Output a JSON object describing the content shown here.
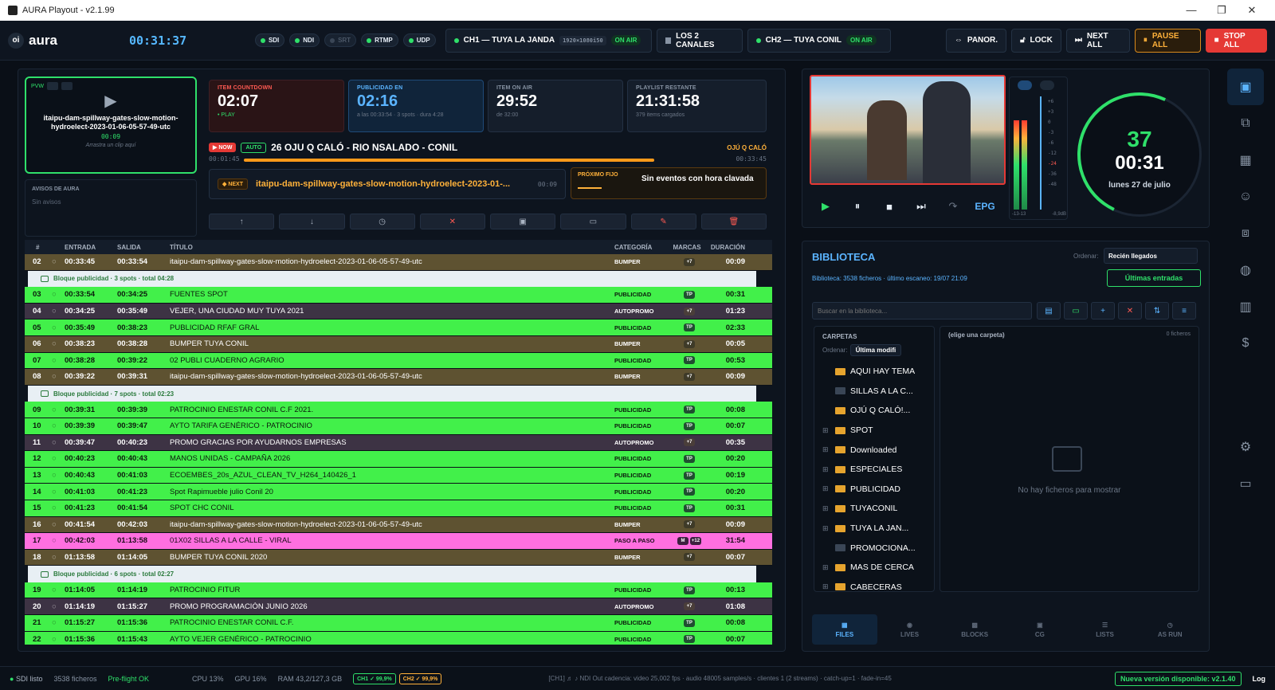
{
  "window": {
    "title": "AURA Playout - v2.1.99",
    "controls": [
      "—",
      "❐",
      "✕"
    ]
  },
  "top": {
    "logo_mark": "oi",
    "logo": "aura",
    "clock": "00:31:37",
    "io": [
      {
        "label": "SDI",
        "on": true
      },
      {
        "label": "NDI",
        "on": true
      },
      {
        "label": "SRT",
        "on": false
      },
      {
        "label": "RTMP",
        "on": true
      },
      {
        "label": "UDP",
        "on": true
      }
    ],
    "ch1": {
      "label": "CH1 — TUYA LA JANDA",
      "res": "1920×1080i50",
      "status": "ON AIR"
    },
    "both": "LOS 2 CANALES",
    "ch2": {
      "label": "CH2 — TUYA CONIL",
      "status": "ON AIR"
    },
    "buttons": {
      "panor": "PANOR.",
      "lock": "LOCK",
      "next_all": "NEXT ALL",
      "pause_all": "PAUSE ALL",
      "stop_all": "STOP ALL"
    }
  },
  "pvw": {
    "tag": "PVW",
    "file": "itaipu-dam-spillway-gates-slow-motion-hydroelect-2023-01-06-05-57-49-utc",
    "dur": "00:09",
    "hint": "Arrastra un clip aquí"
  },
  "avisos": {
    "title": "AVISOS DE AURA",
    "body": "Sin avisos"
  },
  "cards": [
    {
      "label": "ITEM COUNTDOWN",
      "value": "02:07",
      "sub": "• PLAY"
    },
    {
      "label": "PUBLICIDAD EN",
      "value": "02:16",
      "sub": "a las 00:33:54 · 3 spots · dura 4:28"
    },
    {
      "label": "ITEM ON AIR",
      "value": "29:52",
      "sub": "de 32:00"
    },
    {
      "label": "PLAYLIST RESTANTE",
      "value": "21:31:58",
      "sub": "379 items cargados"
    }
  ],
  "now": {
    "badge": "▶ NOW",
    "auto": "AUTO",
    "title": "26 OJU Q CALÓ - RIO NSALADO - CONIL",
    "category": "OJÚ Q CALÓ",
    "elapsed": "00:01:45",
    "total": "00:33:45",
    "progress": 0.9
  },
  "next": {
    "badge": "◆ NEXT",
    "title": "itaipu-dam-spillway-gates-slow-motion-hydroelect-2023-01-...",
    "dur": "00:09"
  },
  "fijo": {
    "label": "PRÓXIMO FIJO",
    "value": "Sin eventos con hora clavada"
  },
  "actions": [
    "↑",
    "↓",
    "◷",
    "✕",
    "▣",
    "▭",
    "✎",
    "🗑"
  ],
  "playlist": {
    "headers": [
      "#",
      "",
      "ENTRADA",
      "SALIDA",
      "TÍTULO",
      "CATEGORÍA",
      "MARCAS",
      "DURACIÓN"
    ],
    "rows": [
      {
        "t": "r",
        "n": "02",
        "in": "00:33:45",
        "out": "00:33:54",
        "title": "itaipu-dam-spillway-gates-slow-motion-hydroelect-2023-01-06-05-57-49-utc",
        "cat": "BUMPER",
        "mk": [
          "+7"
        ],
        "dur": "00:09",
        "cls": "bump"
      },
      {
        "t": "b",
        "label": "Bloque publicidad · 3 spots · total 04:28"
      },
      {
        "t": "r",
        "n": "03",
        "in": "00:33:54",
        "out": "00:34:25",
        "title": "FUENTES SPOT",
        "cat": "PUBLICIDAD",
        "mk": [
          "TP"
        ],
        "dur": "00:31",
        "cls": "spot"
      },
      {
        "t": "r",
        "n": "04",
        "in": "00:34:25",
        "out": "00:35:49",
        "title": "VEJER, UNA CIUDAD MUY TUYA 2021",
        "cat": "AUTOPROMO",
        "mk": [
          "+7"
        ],
        "dur": "01:23",
        "cls": "auto"
      },
      {
        "t": "r",
        "n": "05",
        "in": "00:35:49",
        "out": "00:38:23",
        "title": "PUBLICIDAD RFAF GRAL",
        "cat": "PUBLICIDAD",
        "mk": [
          "TP"
        ],
        "dur": "02:33",
        "cls": "spot"
      },
      {
        "t": "r",
        "n": "06",
        "in": "00:38:23",
        "out": "00:38:28",
        "title": "BUMPER TUYA CONIL",
        "cat": "BUMPER",
        "mk": [
          "+7"
        ],
        "dur": "00:05",
        "cls": "bump"
      },
      {
        "t": "r",
        "n": "07",
        "in": "00:38:28",
        "out": "00:39:22",
        "title": "02 PUBLI CUADERNO AGRARIO",
        "cat": "PUBLICIDAD",
        "mk": [
          "TP"
        ],
        "dur": "00:53",
        "cls": "spot"
      },
      {
        "t": "r",
        "n": "08",
        "in": "00:39:22",
        "out": "00:39:31",
        "title": "itaipu-dam-spillway-gates-slow-motion-hydroelect-2023-01-06-05-57-49-utc",
        "cat": "BUMPER",
        "mk": [
          "+7"
        ],
        "dur": "00:09",
        "cls": "bump"
      },
      {
        "t": "b",
        "label": "Bloque publicidad · 7 spots · total 02:23"
      },
      {
        "t": "r",
        "n": "09",
        "in": "00:39:31",
        "out": "00:39:39",
        "title": "PATROCINIO ENESTAR CONIL C.F 2021.",
        "cat": "PUBLICIDAD",
        "mk": [
          "TP"
        ],
        "dur": "00:08",
        "cls": "spot"
      },
      {
        "t": "r",
        "n": "10",
        "in": "00:39:39",
        "out": "00:39:47",
        "title": "AYTO TARIFA GENÉRICO - PATROCINIO",
        "cat": "PUBLICIDAD",
        "mk": [
          "TP"
        ],
        "dur": "00:07",
        "cls": "spot"
      },
      {
        "t": "r",
        "n": "11",
        "in": "00:39:47",
        "out": "00:40:23",
        "title": "PROMO GRACIAS POR AYUDARNOS EMPRESAS",
        "cat": "AUTOPROMO",
        "mk": [
          "+7"
        ],
        "dur": "00:35",
        "cls": "auto"
      },
      {
        "t": "r",
        "n": "12",
        "in": "00:40:23",
        "out": "00:40:43",
        "title": "MANOS UNIDAS - CAMPAÑA 2026",
        "cat": "PUBLICIDAD",
        "mk": [
          "TP"
        ],
        "dur": "00:20",
        "cls": "spot"
      },
      {
        "t": "r",
        "n": "13",
        "in": "00:40:43",
        "out": "00:41:03",
        "title": "ECOEMBES_20s_AZUL_CLEAN_TV_H264_140426_1",
        "cat": "PUBLICIDAD",
        "mk": [
          "TP"
        ],
        "dur": "00:19",
        "cls": "spot"
      },
      {
        "t": "r",
        "n": "14",
        "in": "00:41:03",
        "out": "00:41:23",
        "title": "Spot Rapimueble julio Conil 20",
        "cat": "PUBLICIDAD",
        "mk": [
          "TP"
        ],
        "dur": "00:20",
        "cls": "spot"
      },
      {
        "t": "r",
        "n": "15",
        "in": "00:41:23",
        "out": "00:41:54",
        "title": "SPOT CHC CONIL",
        "cat": "PUBLICIDAD",
        "mk": [
          "TP"
        ],
        "dur": "00:31",
        "cls": "spot"
      },
      {
        "t": "r",
        "n": "16",
        "in": "00:41:54",
        "out": "00:42:03",
        "title": "itaipu-dam-spillway-gates-slow-motion-hydroelect-2023-01-06-05-57-49-utc",
        "cat": "BUMPER",
        "mk": [
          "+7"
        ],
        "dur": "00:09",
        "cls": "bump"
      },
      {
        "t": "r",
        "n": "17",
        "in": "00:42:03",
        "out": "01:13:58",
        "title": "01X02 SILLAS A LA CALLE - VIRAL",
        "cat": "PASO A PASO",
        "mk": [
          "M",
          "+12"
        ],
        "dur": "31:54",
        "cls": "paso"
      },
      {
        "t": "r",
        "n": "18",
        "in": "01:13:58",
        "out": "01:14:05",
        "title": "BUMPER TUYA CONIL 2020",
        "cat": "BUMPER",
        "mk": [
          "+7"
        ],
        "dur": "00:07",
        "cls": "bump"
      },
      {
        "t": "b",
        "label": "Bloque publicidad · 6 spots · total 02:27"
      },
      {
        "t": "r",
        "n": "19",
        "in": "01:14:05",
        "out": "01:14:19",
        "title": "PATROCINIO FITUR",
        "cat": "PUBLICIDAD",
        "mk": [
          "TP"
        ],
        "dur": "00:13",
        "cls": "spot"
      },
      {
        "t": "r",
        "n": "20",
        "in": "01:14:19",
        "out": "01:15:27",
        "title": "PROMO PROGRAMACIÓN JUNIO 2026",
        "cat": "AUTOPROMO",
        "mk": [
          "+7"
        ],
        "dur": "01:08",
        "cls": "auto"
      },
      {
        "t": "r",
        "n": "21",
        "in": "01:15:27",
        "out": "01:15:36",
        "title": "PATROCINIO ENESTAR CONIL C.F.",
        "cat": "PUBLICIDAD",
        "mk": [
          "TP"
        ],
        "dur": "00:08",
        "cls": "spot"
      },
      {
        "t": "r",
        "n": "22",
        "in": "01:15:36",
        "out": "01:15:43",
        "title": "AYTO VEJER GENÉRICO - PATROCINIO",
        "cat": "PUBLICIDAD",
        "mk": [
          "TP"
        ],
        "dur": "00:07",
        "cls": "spot"
      }
    ]
  },
  "player": {
    "epg": "EPG"
  },
  "vu": {
    "scale": [
      "+6",
      "+3",
      "0",
      "-3",
      "-6",
      "-12",
      "-24",
      "-36",
      "-48"
    ],
    "left": "-13-13",
    "right": "-8,9dB"
  },
  "clockring": {
    "number": "37",
    "time": "00:31",
    "date": "lunes 27 de julio"
  },
  "library": {
    "title": "BIBLIOTECA",
    "order_label": "Ordenar:",
    "order_value": "Recién llegados",
    "stat": "Biblioteca: 3538 ficheros · último escaneo: 19/07 21:09",
    "latest": "Últimas entradas",
    "search_placeholder": "Buscar en la biblioteca...",
    "tree_title": "CARPETAS",
    "tree_order_label": "Ordenar:",
    "tree_order_value": "Última modifi",
    "folders": [
      {
        "name": "AQUI HAY TEMA",
        "plus": false,
        "empty": false
      },
      {
        "name": "SILLAS A LA C...",
        "plus": false,
        "empty": true
      },
      {
        "name": "OJÚ Q CALÓ!...",
        "plus": false,
        "empty": false
      },
      {
        "name": "SPOT",
        "plus": true,
        "empty": false
      },
      {
        "name": "Downloaded",
        "plus": true,
        "empty": false
      },
      {
        "name": "ESPECIALES",
        "plus": true,
        "empty": false
      },
      {
        "name": "PUBLICIDAD",
        "plus": true,
        "empty": false
      },
      {
        "name": "TUYACONIL",
        "plus": true,
        "empty": false
      },
      {
        "name": "TUYA LA JAN...",
        "plus": true,
        "empty": false
      },
      {
        "name": "PROMOCIONA...",
        "plus": false,
        "empty": true
      },
      {
        "name": "MAS DE CERCA",
        "plus": true,
        "empty": false
      },
      {
        "name": "CABECERAS",
        "plus": true,
        "empty": false
      }
    ],
    "files_title": "(elige una carpeta)",
    "files_count": "0 ficheros",
    "files_empty": "No hay ficheros para mostrar",
    "tabs": [
      "FILES",
      "LIVES",
      "BLOCKS",
      "CG",
      "LISTS",
      "AS RUN"
    ]
  },
  "status": {
    "sdi": "SDI listo",
    "files": "3538 ficheros",
    "preflight": "Pre-flight OK",
    "cpu": "CPU 13%",
    "gpu": "GPU 16%",
    "ram": "RAM 43,2/127,3 GB",
    "ch1": "CH1 ✓ 99,9%",
    "ch2": "CH2 ✓ 99,9%",
    "msg": "[CH1] ♬ ♪ NDI Out cadencia: video 25,002 fps · audio 48005 samples/s · clientes 1 (2 streams) · catch-up=1 · fade-in=45",
    "update": "Nueva versión disponible: v2.1.40",
    "log": "Log"
  }
}
